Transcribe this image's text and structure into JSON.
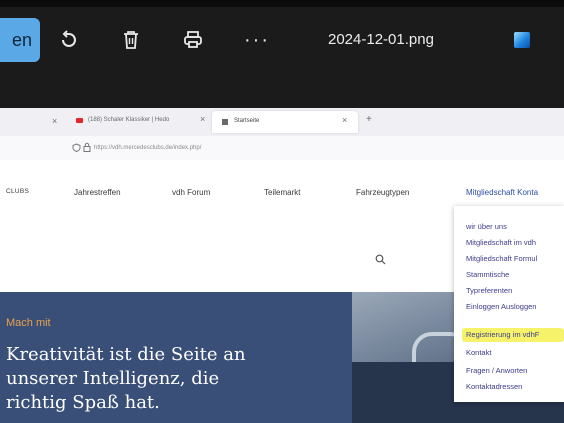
{
  "viewer": {
    "edit_label": "en",
    "file_name": "2024-12-01.png",
    "icons": [
      "rotate-icon",
      "delete-icon",
      "print-icon",
      "more-icon",
      "edit-with-app-icon"
    ]
  },
  "browser": {
    "tabs": [
      {
        "label": "(188) Schaler Klassiker | Hedo",
        "close": "×"
      },
      {
        "label": "Startseite",
        "close": "×"
      }
    ],
    "tab_close_left": "×",
    "new_tab": "+",
    "url": "https://vdh.mercedesclubs.de/index.php/"
  },
  "site": {
    "nav": [
      "CLUBS",
      "Jahrestreffen",
      "vdh Forum",
      "Teilemarkt",
      "Fahrzeugtypen",
      "Mitgliedschaft Konta"
    ],
    "search_icon": "search-icon",
    "dropdown": [
      "wir über uns",
      "Mitgliedschaft im vdh",
      "Mitgliedschaft Formul",
      "Stammtische",
      "Typreferenten",
      "Einloggen Ausloggen",
      "Registrierung im vdhF",
      "Kontakt",
      "Fragen / Anworten",
      "Kontaktadressen"
    ],
    "hero": {
      "kicker": "Mach mit",
      "lines": [
        "Kreativität ist die Seite an",
        "unserer Intelligenz, die",
        "richtig Spaß hat."
      ]
    }
  }
}
